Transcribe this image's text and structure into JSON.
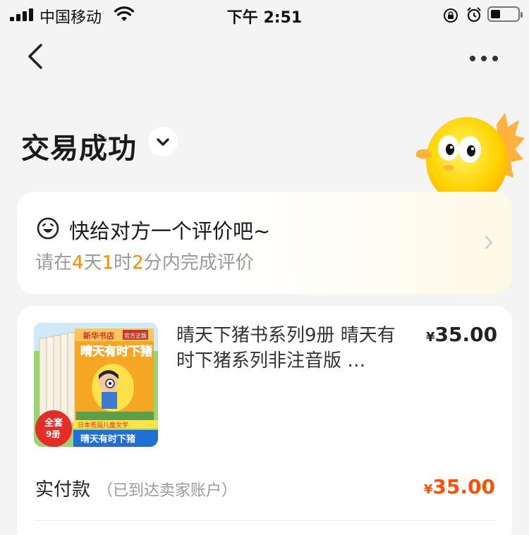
{
  "status_bar": {
    "carrier": "中国移动",
    "time": "下午 2:51"
  },
  "header": {
    "title": "交易成功"
  },
  "review": {
    "title": "快给对方一个评价吧~",
    "deadline_prefix": "请在",
    "days": "4",
    "days_unit": "天",
    "hours": "1",
    "hours_unit": "时",
    "minutes": "2",
    "minutes_unit": "分内完成评价"
  },
  "product": {
    "name": "晴天下猪书系列9册 晴天有时下猪系列非注音版 …",
    "price_symbol": "¥",
    "price": "35.00",
    "thumb": {
      "publisher": "新华书店",
      "publisher_tag": "官方正版",
      "series_title": "晴天有时下猪",
      "badge_top": "全套",
      "badge_bottom": "9册",
      "band_text": "日本荒诞儿童文学",
      "cover_title": "晴天有时下猪"
    }
  },
  "payment": {
    "label": "实付款",
    "note": "（已到达卖家账户）",
    "amount_symbol": "¥",
    "amount": "35.00"
  },
  "colors": {
    "accent_orange": "#ff8a00",
    "price_orange": "#ff5000",
    "background": "#f4f4f4"
  },
  "icons": [
    "signal-icon",
    "wifi-icon",
    "rotation-lock-icon",
    "alarm-icon",
    "battery-icon",
    "back-icon",
    "more-icon",
    "chevron-down-icon",
    "smile-face-icon",
    "chevron-right-icon",
    "mascot-icon"
  ]
}
